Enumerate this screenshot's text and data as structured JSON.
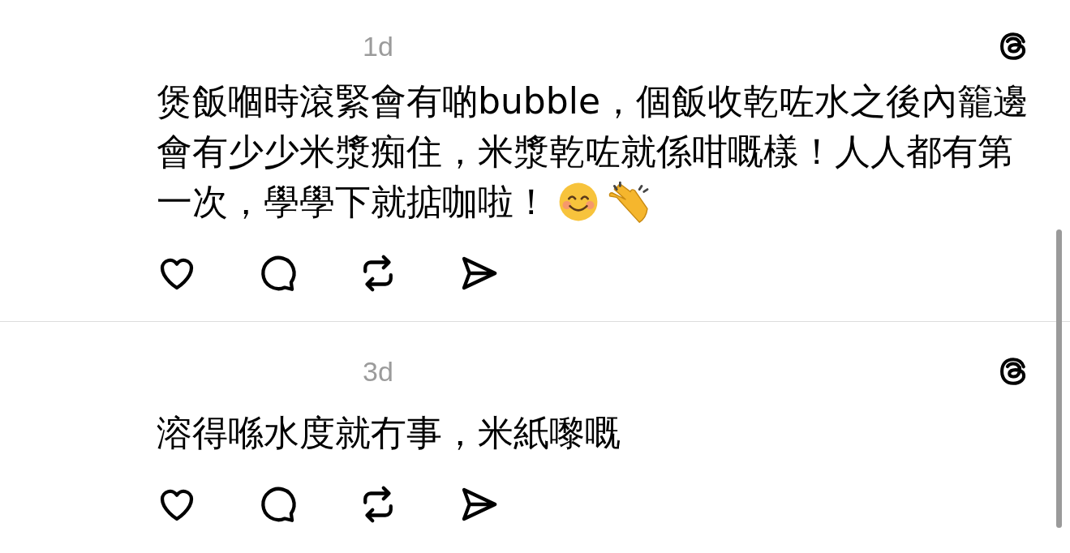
{
  "posts": [
    {
      "time": "1d",
      "lines": [
        "煲飯嗰時滾緊會有啲bubble，個飯收乾咗水之後內籠邊",
        "會有少少米漿痴住，米漿乾咗就係咁嘅樣！人人都有第",
        "一次，學學下就掂咖啦！"
      ],
      "emojis": [
        {
          "kind": "smiling-face"
        },
        {
          "kind": "clapping-hands"
        }
      ]
    },
    {
      "time": "3d",
      "lines": [
        "溶得喺水度就冇事，米紙嚟嘅"
      ]
    }
  ]
}
